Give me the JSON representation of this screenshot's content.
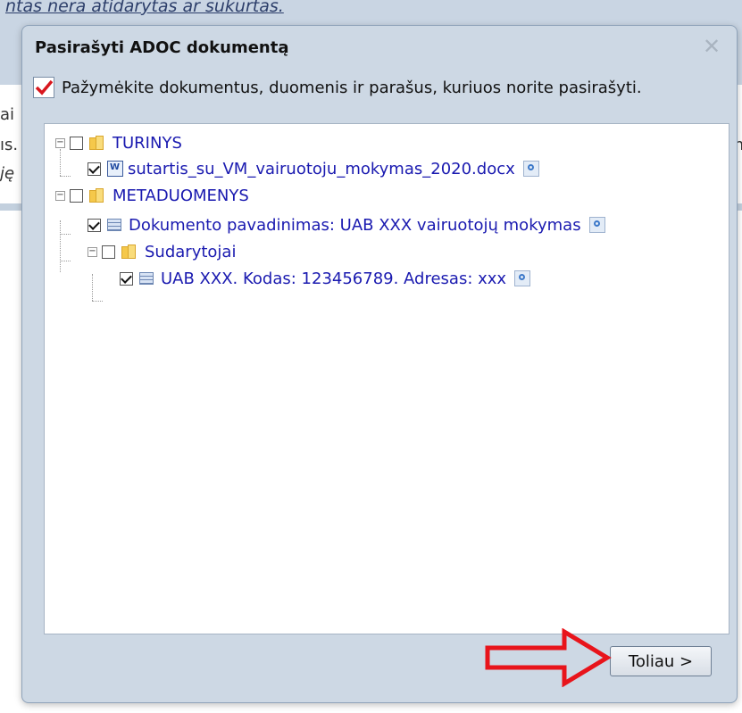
{
  "background": {
    "banner_text": "ntas nera atidarytas ar sukurtas.",
    "left_fragments": [
      "ai",
      "ıs.",
      "ję"
    ],
    "right_fragment": "m"
  },
  "dialog": {
    "title": "Pasirašyti ADOC dokumentą",
    "close_label": "✕",
    "instruction": "Pažymėkite dokumentus, duomenis ir parašus, kuriuos norite pasirašyti.",
    "tree": [
      {
        "label": "TURINYS",
        "checked": false,
        "type": "folder"
      },
      {
        "label": "sutartis_su_VM_vairuotoju_mokymas_2020.docx",
        "checked": true,
        "type": "document"
      },
      {
        "label": "METADUOMENYS",
        "checked": false,
        "type": "folder"
      },
      {
        "label": "Dokumento pavadinimas: UAB XXX vairuotojų mokymas",
        "checked": true,
        "type": "metadata"
      },
      {
        "label": "Sudarytojai",
        "checked": false,
        "type": "folder"
      },
      {
        "label": "UAB XXX. Kodas: 123456789. Adresas: xxx",
        "checked": true,
        "type": "metadata"
      }
    ],
    "next_button": "Toliau >"
  },
  "colors": {
    "annotation_arrow": "#e8141b",
    "link_blue": "#1a1ab0",
    "dialog_bg": "#cdd8e4"
  }
}
